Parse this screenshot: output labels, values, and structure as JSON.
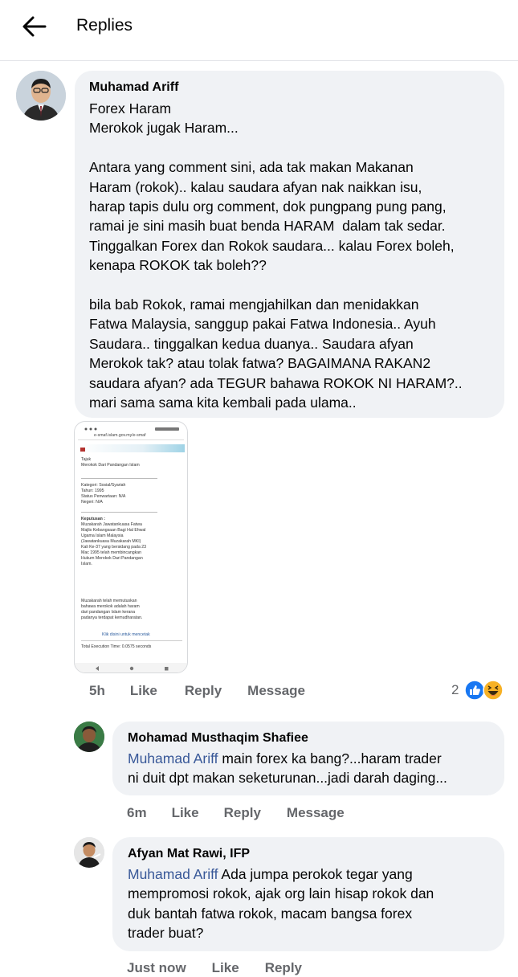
{
  "header": {
    "title": "Replies"
  },
  "main_comment": {
    "author": "Muhamad Ariff",
    "lines": [
      "Forex Haram",
      "Merokok jugak Haram...",
      "",
      "Antara yang comment sini, ada tak makan Makanan",
      "Haram (rokok).. kalau saudara afyan nak naikkan isu,",
      "harap tapis dulu org comment, dok pungpang pung pang,",
      "ramai je sini masih buat benda HARAM  dalam tak sedar.",
      "Tinggalkan Forex dan Rokok saudara... kalau Forex boleh,",
      "kenapa ROKOK tak boleh??",
      "",
      "bila bab Rokok, ramai mengjahilkan dan menidakkan",
      "Fatwa Malaysia, sanggup pakai Fatwa Indonesia.. Ayuh",
      "Saudara.. tinggalkan kedua duanya.. Saudara afyan",
      "Merokok tak? atau tolak fatwa? BAGAIMANA RAKAN2",
      "saudara afyan? ada TEGUR bahawa ROKOK NI HARAM?..",
      "mari sama sama kita kembali pada ulama.."
    ],
    "time": "5h",
    "like": "Like",
    "reply": "Reply",
    "message": "Message",
    "reaction_count": "2",
    "attachment": {
      "url": "e-smaf.islam.gov.my/e-smaf",
      "tajuk_label": "Tajuk",
      "tajuk": "Merokok Dari Pandangan Islam",
      "meta": [
        "Kategori: Sosial/Syariah",
        "Tahun: 1995",
        "Status Penwartaan: N/A",
        "Negeri: N/A"
      ],
      "keputusan_label": "Keputusan :",
      "keputusan": [
        "Muzakarah Jawatankuasa Fatwa",
        "Majlis Kebangsaan Bagi Hal Ehwal",
        "Ugama Islam Malaysia",
        "(Jawatankuasa Muzakarah MKI)",
        "Kali Ke-37 yang bersidang pada 23",
        "Mac 1995 telah membincangkan",
        "Hukum Merokok Dari Pandangan",
        "Islam."
      ],
      "decision": [
        "Muzakarah telah memutuskan",
        "bahawa merokok adalah haram",
        "dari pandangan Islam kerana",
        "padanya terdapat kemudharatan."
      ],
      "print_link": "Klik disini untuk mencetak",
      "exec_time": "Total Execution Time: 0.0575 seconds"
    }
  },
  "replies": [
    {
      "author": "Mohamad Musthaqim Shafiee",
      "mention": "Muhamad Ariff",
      "line1": " main forex ka bang?...haram trader",
      "line2": "ni duit dpt makan seketurunan...jadi darah daging...",
      "time": "6m",
      "like": "Like",
      "reply": "Reply",
      "message": "Message"
    },
    {
      "author": "Afyan Mat Rawi, IFP",
      "mention": "Muhamad Ariff",
      "line1": " Ada jumpa perokok tegar yang",
      "line2": "mempromosi rokok, ajak org lain hisap rokok dan",
      "line3": "duk bantah fatwa rokok, macam bangsa forex",
      "line4": "trader buat?",
      "time": "Just now",
      "like": "Like",
      "reply": "Reply"
    }
  ],
  "colors": {
    "mention": "#385898",
    "bubble": "#f0f2f5",
    "meta_text": "#65676b",
    "like_blue": "#1877f2",
    "haha_yellow": "#f7b125"
  },
  "icons": [
    "back-arrow-icon",
    "like-reaction-icon",
    "haha-reaction-icon"
  ]
}
